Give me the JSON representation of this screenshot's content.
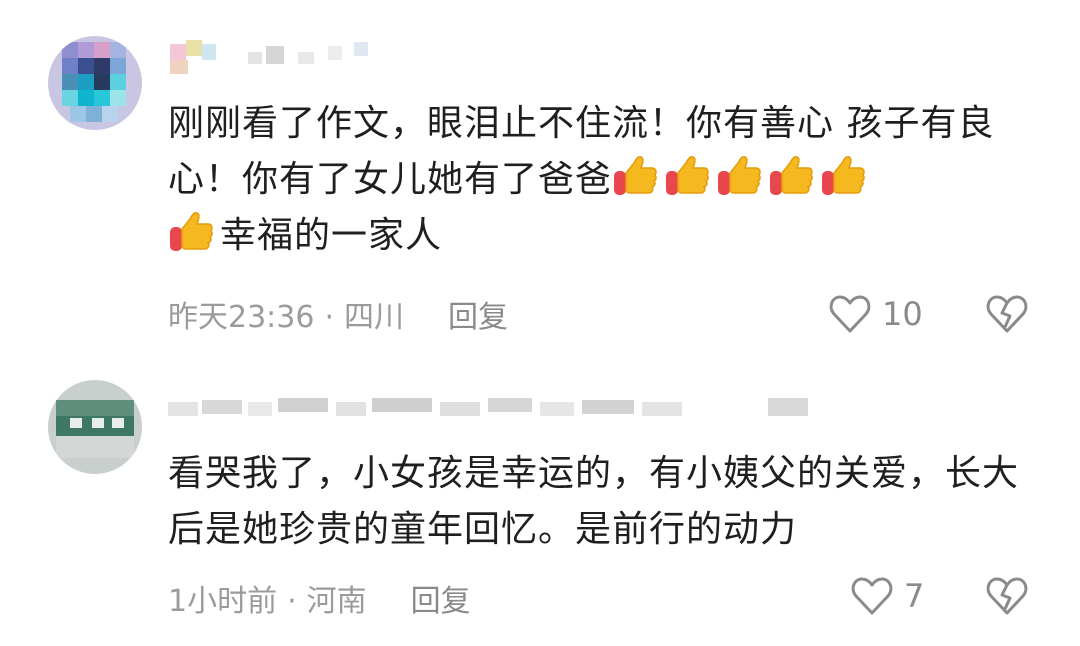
{
  "comments": [
    {
      "text": "刚刚看了作文，眼泪止不住流！你有善心 孩子有良心！你有了女儿她有了爸爸",
      "text_tail": "幸福的一家人",
      "thumbs_count": 6,
      "time": "昨天23:36",
      "separator": "·",
      "location": "四川",
      "reply_label": "回复",
      "likes": "10",
      "like_icon": "heart-outline-icon",
      "dislike_icon": "broken-heart-icon"
    },
    {
      "text": "看哭我了，小女孩是幸运的，有小姨父的关爱，长大后是她珍贵的童年回忆。是前行的动力",
      "time": "1小时前",
      "separator": "·",
      "location": "河南",
      "reply_label": "回复",
      "likes": "7",
      "like_icon": "heart-outline-icon",
      "dislike_icon": "broken-heart-icon"
    }
  ],
  "colors": {
    "meta": "#9b9b9b",
    "text": "#1f1f1f",
    "icon": "#8a8a8a",
    "thumb": "#f6b81f",
    "cuff": "#e8474d"
  }
}
